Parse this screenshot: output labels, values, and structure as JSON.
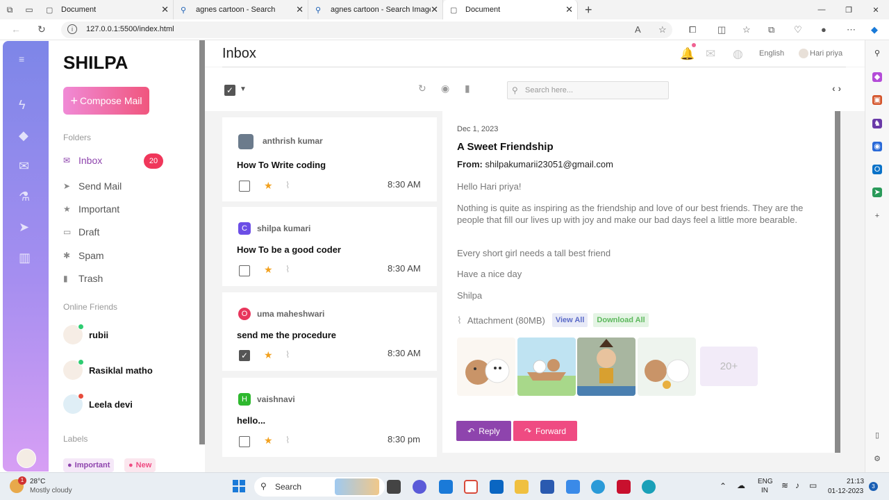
{
  "browser": {
    "tabs": [
      {
        "title": "Document",
        "icon": "page-icon"
      },
      {
        "title": "agnes cartoon - Search",
        "icon": "search-icon"
      },
      {
        "title": "agnes cartoon - Search Images",
        "icon": "search-icon"
      },
      {
        "title": "Document",
        "icon": "page-icon"
      }
    ],
    "url": "127.0.0.1:5500/index.html"
  },
  "sidebar": {
    "brand": "SHILPA",
    "compose_label": "Compose Mail",
    "folders_heading": "Folders",
    "folders": [
      {
        "label": "Inbox",
        "icon": "envelope-icon"
      },
      {
        "label": "Send Mail",
        "icon": "send-icon"
      },
      {
        "label": "Important",
        "icon": "star-icon"
      },
      {
        "label": "Draft",
        "icon": "draft-icon"
      },
      {
        "label": "Spam",
        "icon": "bug-icon"
      },
      {
        "label": "Trash",
        "icon": "trash-icon"
      }
    ],
    "inbox_count": "20",
    "friends_heading": "Online Friends",
    "friends": [
      {
        "name": "rubii",
        "status_color": "#2ecc71"
      },
      {
        "name": "Rasiklal matho",
        "status_color": "#2ecc71"
      },
      {
        "name": "Leela devi",
        "status_color": "#e74c3c"
      }
    ],
    "labels_heading": "Labels",
    "labels": [
      "Important",
      "New"
    ]
  },
  "header": {
    "title": "Inbox",
    "language": "English",
    "user": "Hari priya",
    "search_placeholder": "Search here..."
  },
  "mails": [
    {
      "sender": "anthrish kumar",
      "subject": "How To Write coding",
      "time": "8:30 AM",
      "initial": "",
      "avatar_color": "#6b7b8c",
      "checked": false
    },
    {
      "sender": "shilpa kumari",
      "subject": "How To be a good coder",
      "time": "8:30 AM",
      "initial": "C",
      "avatar_color": "#6c4ee6",
      "checked": false
    },
    {
      "sender": "uma maheshwari",
      "subject": "send me the procedure",
      "time": "8:30 AM",
      "initial": "O",
      "avatar_color": "#e8365c",
      "checked": true
    },
    {
      "sender": "vaishnavi",
      "subject": "hello...",
      "time": "8:30 pm",
      "initial": "H",
      "avatar_color": "#2eb82e",
      "checked": false
    }
  ],
  "reader": {
    "date": "Dec 1, 2023",
    "title": "A Sweet Friendship",
    "from_label": "From:",
    "from_email": "shilpakumarii23051@gmail.com",
    "paragraphs": [
      "Hello Hari priya!",
      "Nothing is quite as inspiring as the friendship and love of our best friends. They are the people that fill our lives up with joy and make our bad days feel a little more bearable.",
      "Every short girl needs a tall best friend",
      "Have a nice day",
      "Shilpa"
    ],
    "attachment_label": "Attachment (80MB)",
    "view_all": "View All",
    "download_all": "Download All",
    "more_count": "20+",
    "reply_label": "Reply",
    "forward_label": "Forward"
  },
  "taskbar": {
    "temperature": "28°C",
    "condition": "Mostly cloudy",
    "weather_badge": "1",
    "search_label": "Search",
    "lang_top": "ENG",
    "lang_bottom": "IN",
    "time": "21:13",
    "date": "01-12-2023",
    "notifications": "3"
  }
}
